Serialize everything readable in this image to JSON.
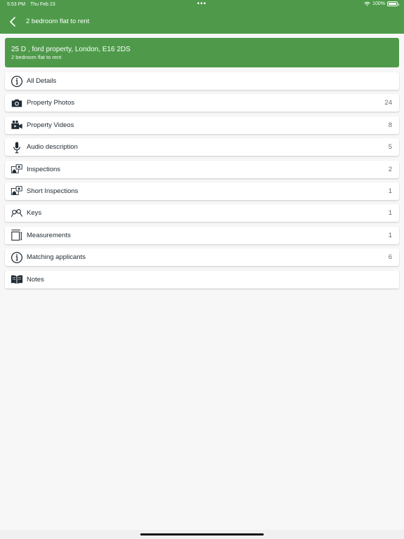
{
  "status_bar": {
    "time": "5:53 PM",
    "date": "Thu Feb 23",
    "dots": "•••",
    "battery": "100%"
  },
  "nav": {
    "title": "2 bedroom flat to rent",
    "back_icon": "chevron-left-icon"
  },
  "header": {
    "address": "25 D , ford property, London, E16 2DS",
    "subtitle": "2 bedroom flat to rent"
  },
  "items": [
    {
      "label": "All Details",
      "count": "",
      "icon": "info-icon"
    },
    {
      "label": "Property Photos",
      "count": "24",
      "icon": "camera-icon"
    },
    {
      "label": "Property Videos",
      "count": "8",
      "icon": "video-camera-icon"
    },
    {
      "label": "Audio description",
      "count": "5",
      "icon": "microphone-icon"
    },
    {
      "label": "Inspections",
      "count": "2",
      "icon": "inspection-icon"
    },
    {
      "label": "Short Inspections",
      "count": "1",
      "icon": "inspection-icon"
    },
    {
      "label": "Keys",
      "count": "1",
      "icon": "keys-icon"
    },
    {
      "label": "Measurements",
      "count": "1",
      "icon": "measure-icon"
    },
    {
      "label": "Matching applicants",
      "count": "6",
      "icon": "info-icon"
    },
    {
      "label": "Notes",
      "count": "",
      "icon": "book-icon"
    }
  ],
  "colors": {
    "brand_green": "#4e9a4a",
    "icon_dark": "#1f2a33",
    "count_gray": "#6b6b6b"
  }
}
